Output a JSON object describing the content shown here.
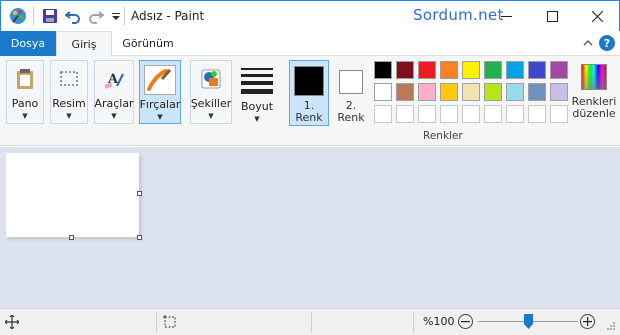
{
  "window": {
    "title": "Adsız - Paint",
    "watermark": "Sordum.net"
  },
  "tabs": {
    "file": "Dosya",
    "home": "Giriş",
    "view": "Görünüm"
  },
  "ribbon": {
    "clipboard": "Pano",
    "image": "Resim",
    "tools": "Araçlar",
    "brushes": "Fırçalar",
    "shapes": "Şekiller",
    "size": "Boyut",
    "color1_line1": "1.",
    "color1_line2": "Renk",
    "color2_line1": "2.",
    "color2_line2": "Renk",
    "colors_group": "Renkler",
    "edit_colors_line1": "Renkleri",
    "edit_colors_line2": "düzenle"
  },
  "colors": {
    "color1": "#000000",
    "color2": "#ffffff",
    "row1": [
      "#000000",
      "#7f0e1f",
      "#ed1c24",
      "#ff7f27",
      "#fff200",
      "#22b14c",
      "#00a2e8",
      "#3f48cc",
      "#a349a4"
    ],
    "row2": [
      "#ffffff",
      "#b97a57",
      "#ffaec9",
      "#ffc90e",
      "#efe4b0",
      "#b5e61d",
      "#99d9ea",
      "#7092be",
      "#c8bfe7"
    ],
    "row3": [
      "#ffffff",
      "#ffffff",
      "#ffffff",
      "#ffffff",
      "#ffffff",
      "#ffffff",
      "#ffffff",
      "#ffffff",
      "#ffffff"
    ]
  },
  "status": {
    "zoom": "%100",
    "zoom_fraction": 0.5
  }
}
